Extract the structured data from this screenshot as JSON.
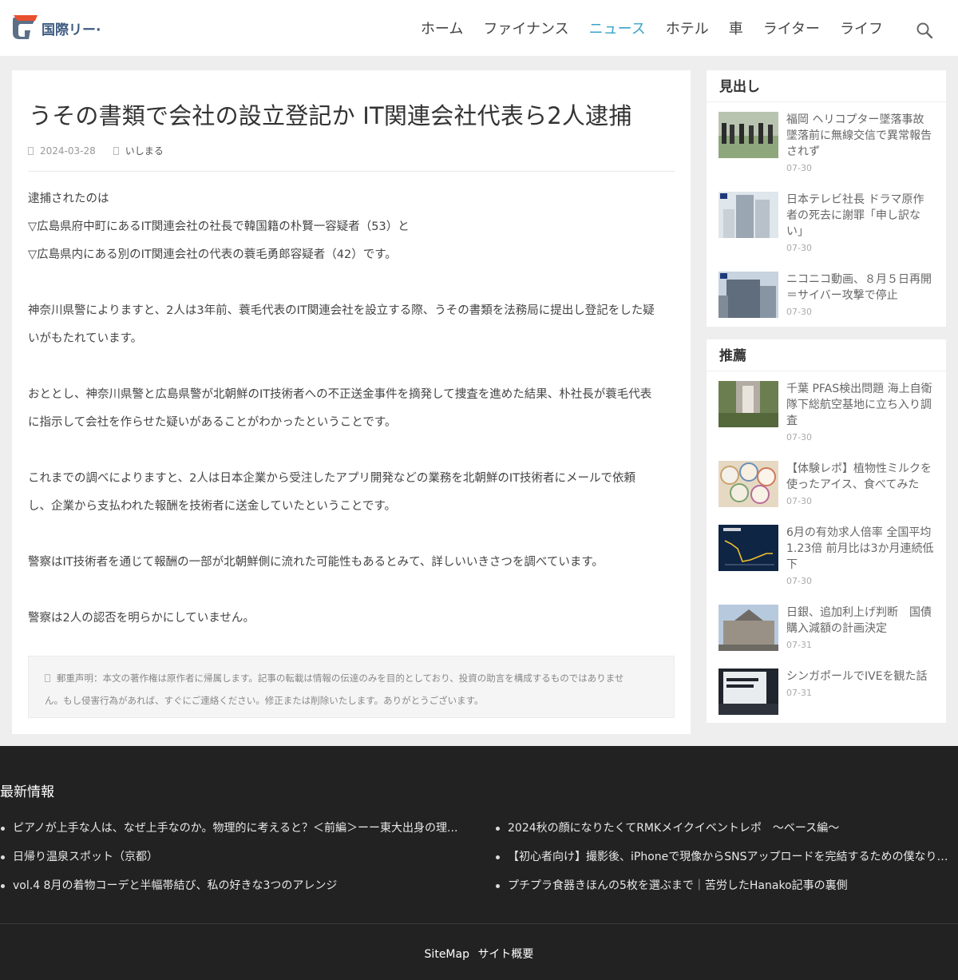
{
  "header": {
    "logo_text": "国際リー·",
    "nav": [
      "ホーム",
      "ファイナンス",
      "ニュース",
      "ホテル",
      "車",
      "ライター",
      "ライフ"
    ],
    "active_nav": "ニュース",
    "accent_color": "#3aa3c9",
    "search_icon": "search-icon"
  },
  "article": {
    "title": "うその書類で会社の設立登記か IT関連会社代表ら2人逮捕",
    "date": "2024-03-28",
    "author": "いしまる",
    "paragraphs": [
      "逮捕されたのは",
      "▽広島県府中町にあるIT関連会社の社長で韓国籍の朴賢一容疑者（53）と",
      "▽広島県内にある別のIT関連会社の代表の蓑毛勇郎容疑者（42）です。",
      "",
      "神奈川県警によりますと、2人は3年前、蓑毛代表のIT関連会社を設立する際、うその書類を法務局に提出し登記をした疑",
      "いがもたれています。",
      "",
      "おととし、神奈川県警と広島県警が北朝鮮のIT技術者への不正送金事件を摘発して捜査を進めた結果、朴社長が蓑毛代表",
      "に指示して会社を作らせた疑いがあることがわかったということです。",
      "",
      "これまでの調べによりますと、2人は日本企業から受注したアプリ開発などの業務を北朝鮮のIT技術者にメールで依頼",
      "し、企業から支払われた報酬を技術者に送金していたということです。",
      "",
      "警察はIT技術者を通じて報酬の一部が北朝鮮側に流れた可能性もあるとみて、詳しいいきさつを調べています。",
      "",
      "警察は2人の認否を明らかにしていません。"
    ],
    "notice_line1": "郵重声明：本文の著作権は原作者に帰属します。記事の転載は情報の伝達のみを目的としており、投資の助言を構成するものではありませ",
    "notice_line2": "ん。もし侵害行為があれば、すぐにご連絡ください。修正または削除いたします。ありがとうございます。"
  },
  "sidebar": {
    "headlines": {
      "title": "見出し",
      "posts": [
        {
          "title": "福岡 ヘリコプター墜落事故 墜落前に無線交信で異常報告されず",
          "date": "07-30"
        },
        {
          "title": "日本テレビ社長 ドラマ原作者の死去に謝罪「申し訳ない」",
          "date": "07-30"
        },
        {
          "title": "ニコニコ動画、８月５日再開＝サイバー攻撃で停止",
          "date": "07-30"
        }
      ]
    },
    "recommended": {
      "title": "推薦",
      "posts": [
        {
          "title": "千葉 PFAS検出問題 海上自衛隊下総航空基地に立ち入り調査",
          "date": "07-30"
        },
        {
          "title": "【体験レポ】植物性ミルクを使ったアイス、食べてみた",
          "date": "07-30"
        },
        {
          "title": "6月の有効求人倍率 全国平均1.23倍 前月比は3か月連続低下",
          "date": "07-30"
        },
        {
          "title": "日銀、追加利上げ判断　国債購入減額の計画決定",
          "date": "07-31"
        },
        {
          "title": "シンガポールでIVEを観た話",
          "date": "07-31"
        }
      ]
    }
  },
  "footer": {
    "title": "最新情報",
    "left": [
      "ピアノが上手な人は、なぜ上手なのか。物理的に考えると？＜前編＞ーー東大出身の理...",
      "日帰り温泉スポット（京都）",
      "vol.4 8月の着物コーデと半幅帯結び、私の好きな3つのアレンジ"
    ],
    "right": [
      "2024秋の顔になりたくてRMKメイクイベントレポ　〜ベース編〜",
      "【初心者向け】撮影後、iPhoneで現像からSNSアップロードを完結するための僕なりの...",
      "プチプラ食器きほんの5枚を選ぶまで｜苦労したHanako記事の裏側"
    ],
    "links": [
      "SiteMap",
      "サイト概要"
    ]
  }
}
